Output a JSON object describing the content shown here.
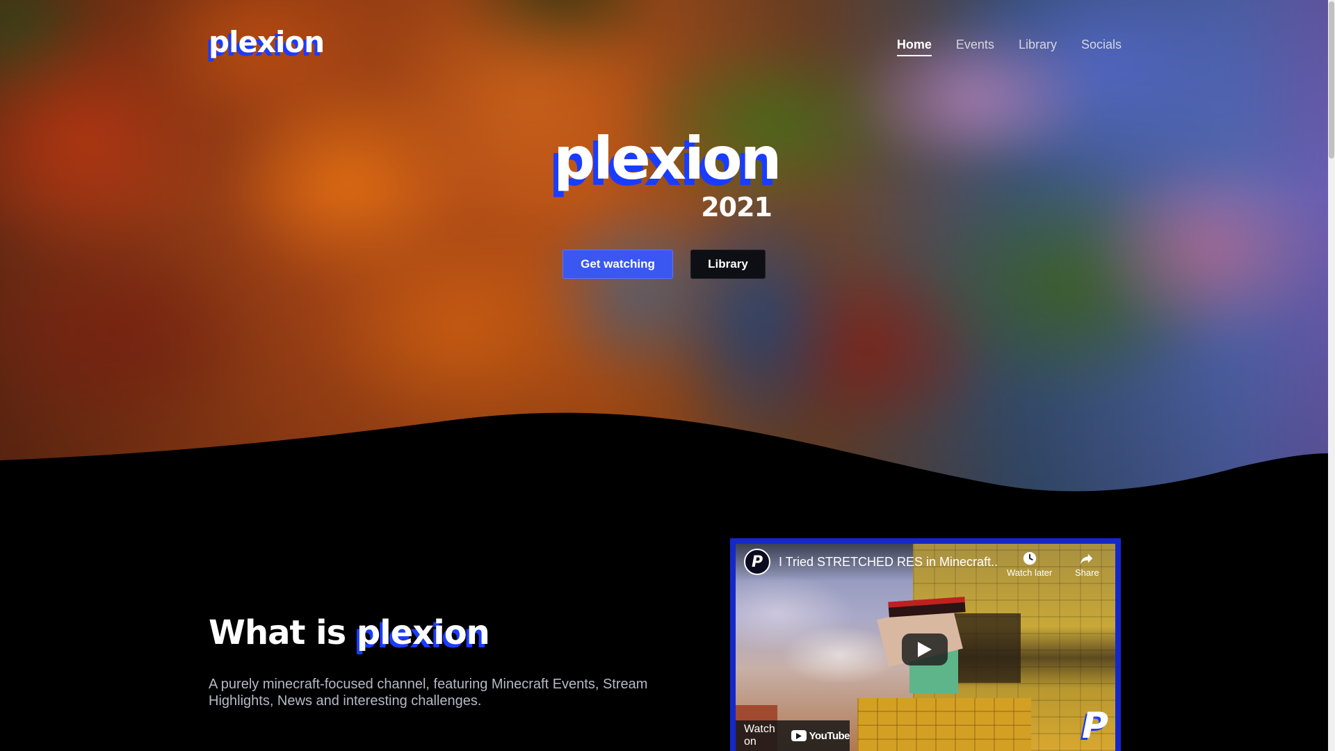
{
  "brand": {
    "logo": "plexion"
  },
  "nav": {
    "items": [
      {
        "label": "Home",
        "active": true
      },
      {
        "label": "Events",
        "active": false
      },
      {
        "label": "Library",
        "active": false
      },
      {
        "label": "Socials",
        "active": false
      }
    ]
  },
  "hero": {
    "title": "plexion",
    "year": "2021",
    "primary_button": "Get watching",
    "secondary_button": "Library"
  },
  "about": {
    "title_prefix": "What is",
    "title_brand": "plexion",
    "description": "A purely minecraft-focused channel, featuring Minecraft Events, Stream Highlights, News and interesting challenges."
  },
  "video": {
    "channel_avatar_letter": "P",
    "title": "I Tried STRETCHED RES in Minecraft..",
    "watch_later_label": "Watch later",
    "share_label": "Share",
    "watch_on_label": "Watch on",
    "youtube_label": "YouTube",
    "watermark_letter": "P",
    "icons": [
      "clock-icon",
      "share-arrow-icon",
      "play-icon",
      "youtube-logo-icon"
    ]
  },
  "colors": {
    "accent": "#1a3cff",
    "primary_button": "#3b57f2",
    "background": "#000000",
    "muted_text": "#b8b8c8"
  }
}
